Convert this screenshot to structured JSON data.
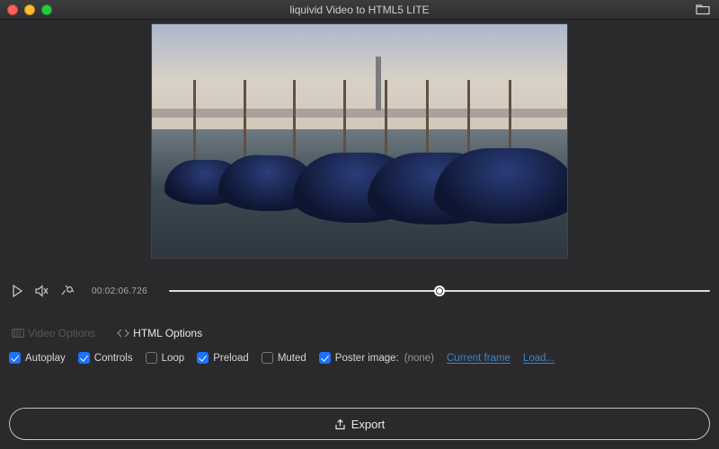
{
  "window": {
    "title": "liquivid Video to HTML5 LITE"
  },
  "playback": {
    "timecode": "00:02:06.726",
    "progress_pct": 50
  },
  "tabs": {
    "video_options": {
      "label": "Video Options",
      "enabled": false,
      "active": false
    },
    "html_options": {
      "label": "HTML Options",
      "enabled": true,
      "active": true
    }
  },
  "options": {
    "autoplay": {
      "label": "Autoplay",
      "checked": true
    },
    "controls": {
      "label": "Controls",
      "checked": true
    },
    "loop": {
      "label": "Loop",
      "checked": false
    },
    "preload": {
      "label": "Preload",
      "checked": true
    },
    "muted": {
      "label": "Muted",
      "checked": false
    },
    "poster": {
      "label": "Poster image:",
      "checked": true,
      "value": "(none)",
      "link_current": "Current frame",
      "link_load": "Load..."
    }
  },
  "actions": {
    "export_label": "Export"
  }
}
